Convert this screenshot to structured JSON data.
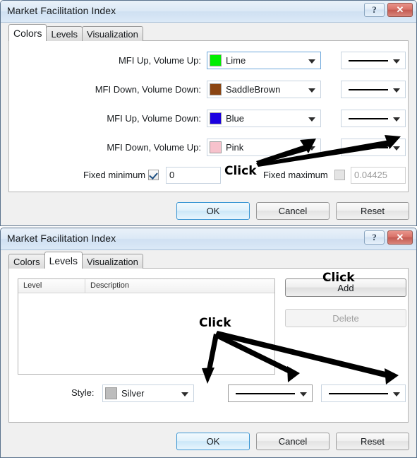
{
  "window_title": "Market Facilitation Index",
  "titlebar_buttons": {
    "help": "?",
    "close": "✕"
  },
  "dialog_colors": {
    "tabs": [
      {
        "label": "Colors",
        "active": true
      },
      {
        "label": "Levels",
        "active": false
      },
      {
        "label": "Visualization",
        "active": false
      }
    ],
    "color_rows": [
      {
        "label": "MFI Up, Volume Up:",
        "color_name": "Lime",
        "color_hex": "#00ee00",
        "focused": true
      },
      {
        "label": "MFI Down, Volume Down:",
        "color_name": "SaddleBrown",
        "color_hex": "#8b4513",
        "focused": false
      },
      {
        "label": "MFI Up, Volume Down:",
        "color_name": "Blue",
        "color_hex": "#1b00e0",
        "focused": false
      },
      {
        "label": "MFI Down, Volume Up:",
        "color_name": "Pink",
        "color_hex": "#f7c2cc",
        "focused": false
      }
    ],
    "fixed_minimum": {
      "label": "Fixed minimum",
      "checked": true,
      "value": "0"
    },
    "fixed_maximum": {
      "label": "Fixed maximum",
      "checked": false,
      "value": "0.04425"
    },
    "buttons": {
      "ok": "OK",
      "cancel": "Cancel",
      "reset": "Reset"
    },
    "annotations": [
      {
        "text": "Click"
      }
    ]
  },
  "dialog_levels": {
    "tabs": [
      {
        "label": "Colors",
        "active": false
      },
      {
        "label": "Levels",
        "active": true
      },
      {
        "label": "Visualization",
        "active": false
      }
    ],
    "list": {
      "columns": [
        "Level",
        "Description"
      ],
      "rows": []
    },
    "side_buttons": {
      "add": "Add",
      "delete": "Delete"
    },
    "style_row": {
      "label": "Style:",
      "color_name": "Silver",
      "color_hex": "#bdbdbd"
    },
    "buttons": {
      "ok": "OK",
      "cancel": "Cancel",
      "reset": "Reset"
    },
    "annotations": [
      {
        "text": "Click"
      },
      {
        "text": "Click"
      }
    ]
  }
}
